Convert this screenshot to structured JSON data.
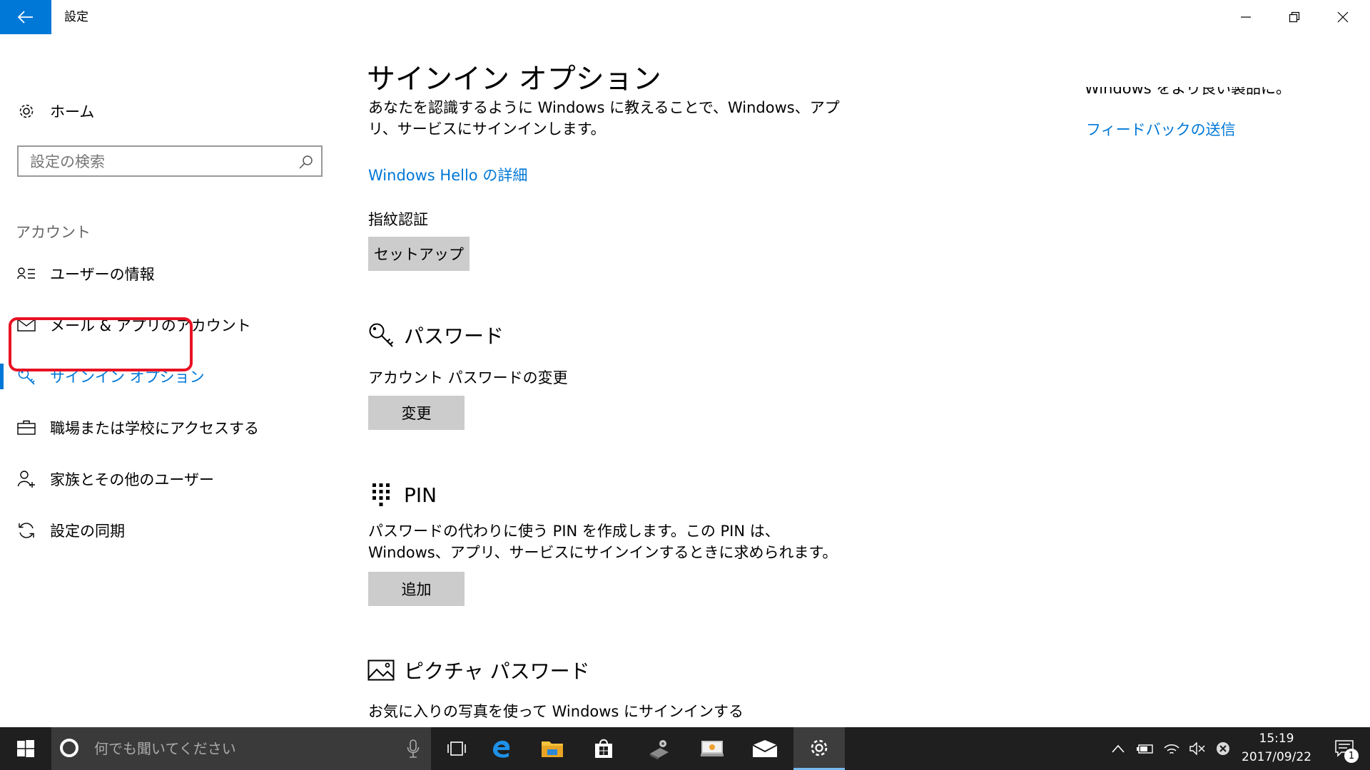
{
  "window": {
    "title": "設定",
    "controls": {
      "minimize": "minimize-icon",
      "maximize": "restore-icon",
      "close": "close-icon"
    }
  },
  "sidebar": {
    "home_label": "ホーム",
    "search_placeholder": "設定の検索",
    "section_label": "アカウント",
    "items": [
      {
        "label": "ユーザーの情報",
        "icon": "user-info-icon"
      },
      {
        "label": "メール & アプリのアカウント",
        "icon": "mail-icon"
      },
      {
        "label": "サインイン オプション",
        "icon": "key-icon",
        "selected": true
      },
      {
        "label": "職場または学校にアクセスする",
        "icon": "briefcase-icon"
      },
      {
        "label": "家族とその他のユーザー",
        "icon": "add-user-icon"
      },
      {
        "label": "設定の同期",
        "icon": "sync-icon"
      }
    ]
  },
  "main": {
    "title": "サインイン オプション",
    "hello": {
      "description": "あなたを認識するように Windows に教えることで、Windows、アプリ、サービスにサインインします。",
      "link": "Windows Hello の詳細",
      "fingerprint_label": "指紋認証",
      "setup_button": "セットアップ"
    },
    "password": {
      "heading": "パスワード",
      "description": "アカウント パスワードの変更",
      "change_button": "変更"
    },
    "pin": {
      "heading": "PIN",
      "description": "パスワードの代わりに使う PIN を作成します。この PIN は、Windows、アプリ、サービスにサインインするときに求められます。",
      "add_button": "追加"
    },
    "picture_password": {
      "heading": "ピクチャ パスワード",
      "description": "お気に入りの写真を使って Windows にサインインする"
    }
  },
  "right_panel": {
    "clipped_text": "Windows をより良い製品に。",
    "feedback_link": "フィードバックの送信"
  },
  "taskbar": {
    "search_placeholder": "何でも聞いてください",
    "time": "15:19",
    "date": "2017/09/22",
    "notification_count": "1"
  },
  "colors": {
    "accent": "#0078d7",
    "highlight_ring": "#e81123",
    "taskbar": "#1f1f1f",
    "button": "#cccccc"
  }
}
